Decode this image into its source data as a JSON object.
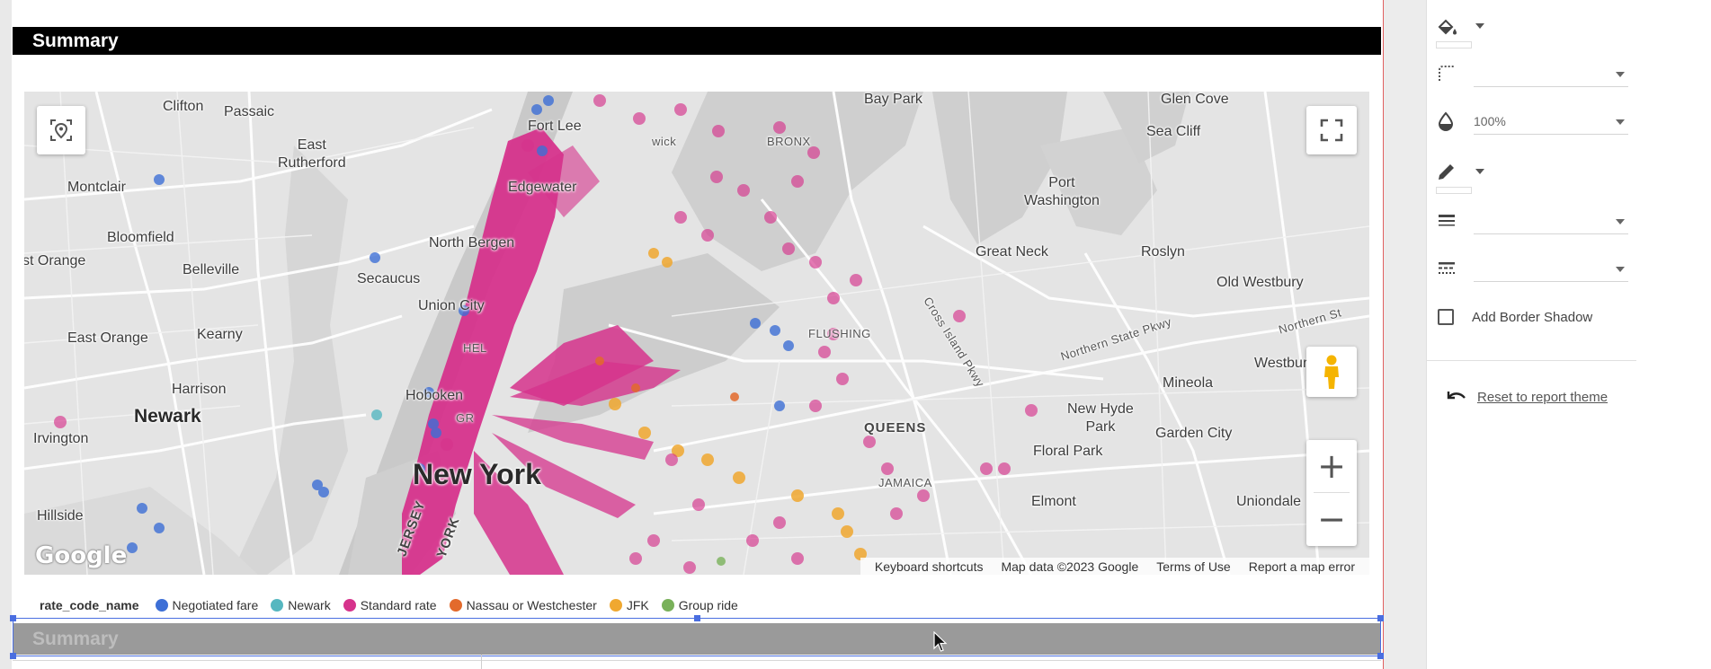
{
  "report": {
    "summary_title": "Summary",
    "summary_title_selected": "Summary"
  },
  "map": {
    "labels": {
      "clifton": "Clifton",
      "passaic": "Passaic",
      "east_rutherford": "East\nRutherford",
      "montclair": "Montclair",
      "bloomfield": "Bloomfield",
      "east_orange": "st Orange",
      "belleville": "Belleville",
      "kearny": "Kearny",
      "east_orange2": "East Orange",
      "harrison": "Harrison",
      "newark": "Newark",
      "irvington": "Irvington",
      "hillside": "Hillside",
      "fort_lee": "Fort Lee",
      "edgewater": "Edgewater",
      "north_bergen": "North Bergen",
      "secaucus": "Secaucus",
      "union_city": "Union City",
      "hoboken": "Hoboken",
      "new_york": "New York",
      "jersey": "JERSEY",
      "york": "YORK",
      "bronx": "BRONX",
      "bay_park": "Bay Park",
      "glen_cove": "Glen Cove",
      "sea_cliff": "Sea Cliff",
      "port_washington": "Port\nWashington",
      "great_neck": "Great Neck",
      "roslyn": "Roslyn",
      "old_westbury": "Old Westbury",
      "flushing": "FLUSHING",
      "westbury": "Westbury",
      "mineola": "Mineola",
      "new_hyde_park": "New Hyde\nPark",
      "floral_park": "Floral Park",
      "garden_city": "Garden City",
      "queens": "QUEENS",
      "jamaica": "JAMAICA",
      "elmont": "Elmont",
      "uniondale": "Uniondale",
      "cross_island": "Cross Island Pkwy",
      "northern_state": "Northern State Pkwy",
      "northern_st": "Northern St",
      "gr": "GR",
      "hel": "HEL",
      "wick": "wick"
    },
    "attribution": {
      "shortcuts": "Keyboard shortcuts",
      "map_data": "Map data ©2023 Google",
      "terms": "Terms of Use",
      "report_error": "Report a map error"
    },
    "logo": "Google",
    "zoom_in": "+",
    "zoom_out": "−"
  },
  "legend": {
    "title": "rate_code_name",
    "items": [
      {
        "label": "Negotiated fare",
        "color": "#3d6fd6"
      },
      {
        "label": "Newark",
        "color": "#56b7c0"
      },
      {
        "label": "Standard rate",
        "color": "#d6338c"
      },
      {
        "label": "Nassau or Westchester",
        "color": "#e36a2c"
      },
      {
        "label": "JFK",
        "color": "#f0a830"
      },
      {
        "label": "Group ride",
        "color": "#79b15a"
      }
    ]
  },
  "panel": {
    "opacity_value": "100%",
    "shadow_label": "Add Border Shadow",
    "reset_label": "Reset to report theme"
  },
  "colors": {
    "standard_rate": "#d6338c",
    "selection": "#4a6ee0"
  }
}
